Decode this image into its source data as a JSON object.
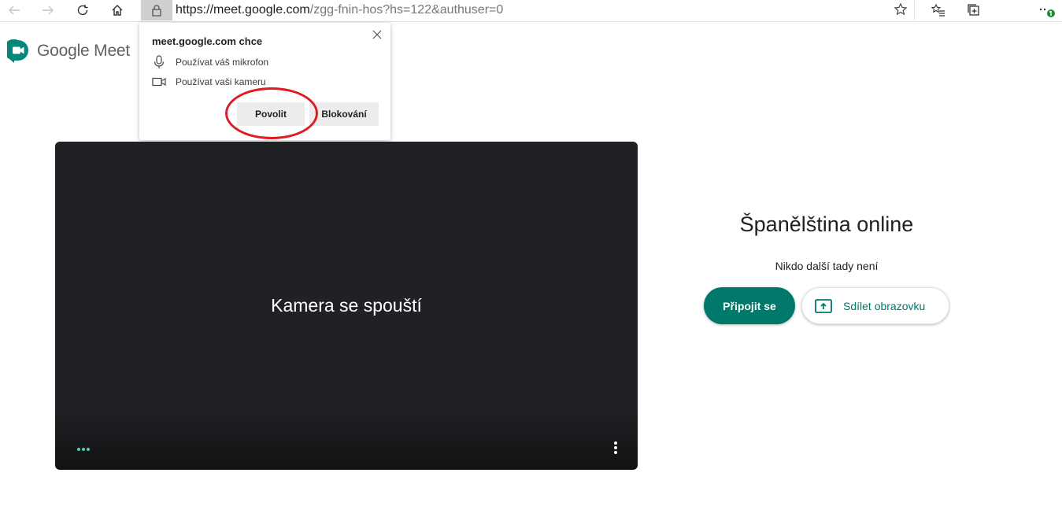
{
  "browser": {
    "url_host": "https://meet.google.com",
    "url_path": "/zgg-fnin-hos?hs=122&authuser=0"
  },
  "logo": {
    "text": "Google Meet"
  },
  "permission_popup": {
    "title": "meet.google.com chce",
    "items": [
      {
        "icon": "microphone-icon",
        "label": "Používat váš mikrofon"
      },
      {
        "icon": "camera-icon",
        "label": "Používat vaši kameru"
      }
    ],
    "allow_label": "Povolit",
    "block_label": "Blokování"
  },
  "preview": {
    "message": "Kamera se spouští"
  },
  "meeting": {
    "title": "Španělština online",
    "subtitle": "Nikdo další tady není",
    "join_label": "Připojit se",
    "share_label": "Sdílet obrazovku"
  },
  "colors": {
    "accent": "#00796b",
    "highlight": "#e01b24",
    "preview_bg": "#202124",
    "dots": "#3ed6b8"
  }
}
